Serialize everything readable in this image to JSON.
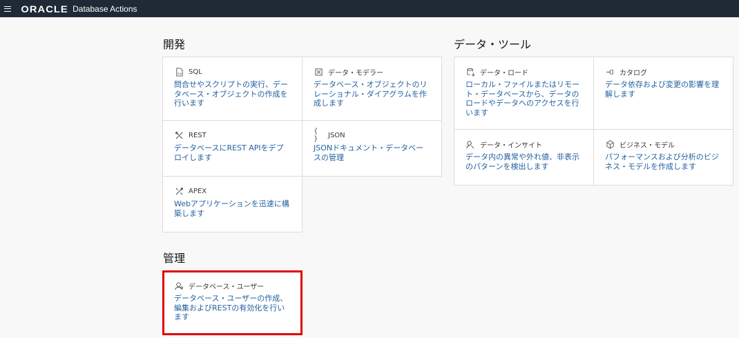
{
  "header": {
    "menu_icon": "hamburger-menu-icon",
    "logo": "ORACLE",
    "app_title": "Database Actions"
  },
  "sections": {
    "development": {
      "title": "開発",
      "tiles": [
        {
          "icon": "sql-icon",
          "label": "SQL",
          "desc": "問合せやスクリプトの実行、データベース・オブジェクトの作成を行います"
        },
        {
          "icon": "data-modeler-icon",
          "label": "データ・モデラー",
          "desc": "データベース・オブジェクトのリレーショナル・ダイアグラムを作成します"
        },
        {
          "icon": "rest-icon",
          "label": "REST",
          "desc": "データベースにREST APIをデプロイします"
        },
        {
          "icon": "json-icon",
          "label": "JSON",
          "desc": "JSONドキュメント・データベースの管理"
        },
        {
          "icon": "apex-icon",
          "label": "APEX",
          "desc": "Webアプリケーションを迅速に構築します"
        }
      ]
    },
    "data_tools": {
      "title": "データ・ツール",
      "tiles": [
        {
          "icon": "data-load-icon",
          "label": "データ・ロード",
          "desc": "ローカル・ファイルまたはリモート・データベースから、データのロードやデータへのアクセスを行います"
        },
        {
          "icon": "catalog-icon",
          "label": "カタログ",
          "desc": "データ依存および変更の影響を理解します"
        },
        {
          "icon": "data-insights-icon",
          "label": "データ・インサイト",
          "desc": "データ内の異常や外れ値、非表示のパターンを検出します"
        },
        {
          "icon": "business-model-icon",
          "label": "ビジネス・モデル",
          "desc": "パフォーマンスおよび分析のビジネス・モデルを作成します"
        }
      ]
    },
    "administration": {
      "title": "管理",
      "tiles": [
        {
          "icon": "database-users-icon",
          "label": "データベース・ユーザー",
          "desc": "データベース・ユーザーの作成、編集およびRESTの有効化を行います"
        }
      ]
    }
  },
  "colors": {
    "header_bg": "#1f2a36",
    "link_blue": "#1f5f9f",
    "highlight": "#e00000"
  }
}
